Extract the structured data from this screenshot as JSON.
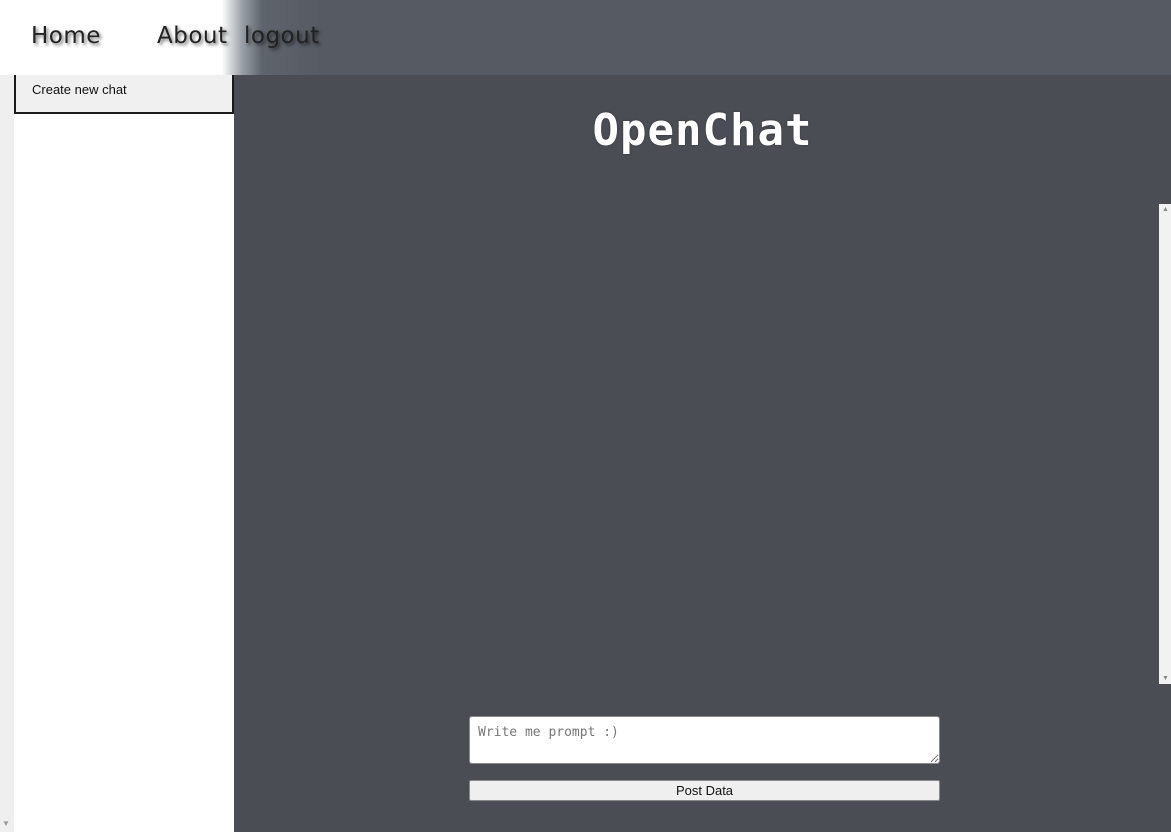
{
  "nav": {
    "home": "Home",
    "about": "About",
    "logout": "logout"
  },
  "sidebar": {
    "new_chat_label": "Create new chat"
  },
  "main": {
    "title": "OpenChat",
    "prompt_placeholder": "Write me prompt :)",
    "prompt_value": "",
    "post_label": "Post Data"
  },
  "colors": {
    "main_background": "#4a4d54",
    "header_dark": "#565b63",
    "sidebar_background": "#ffffff",
    "title_text": "#ffffff"
  }
}
